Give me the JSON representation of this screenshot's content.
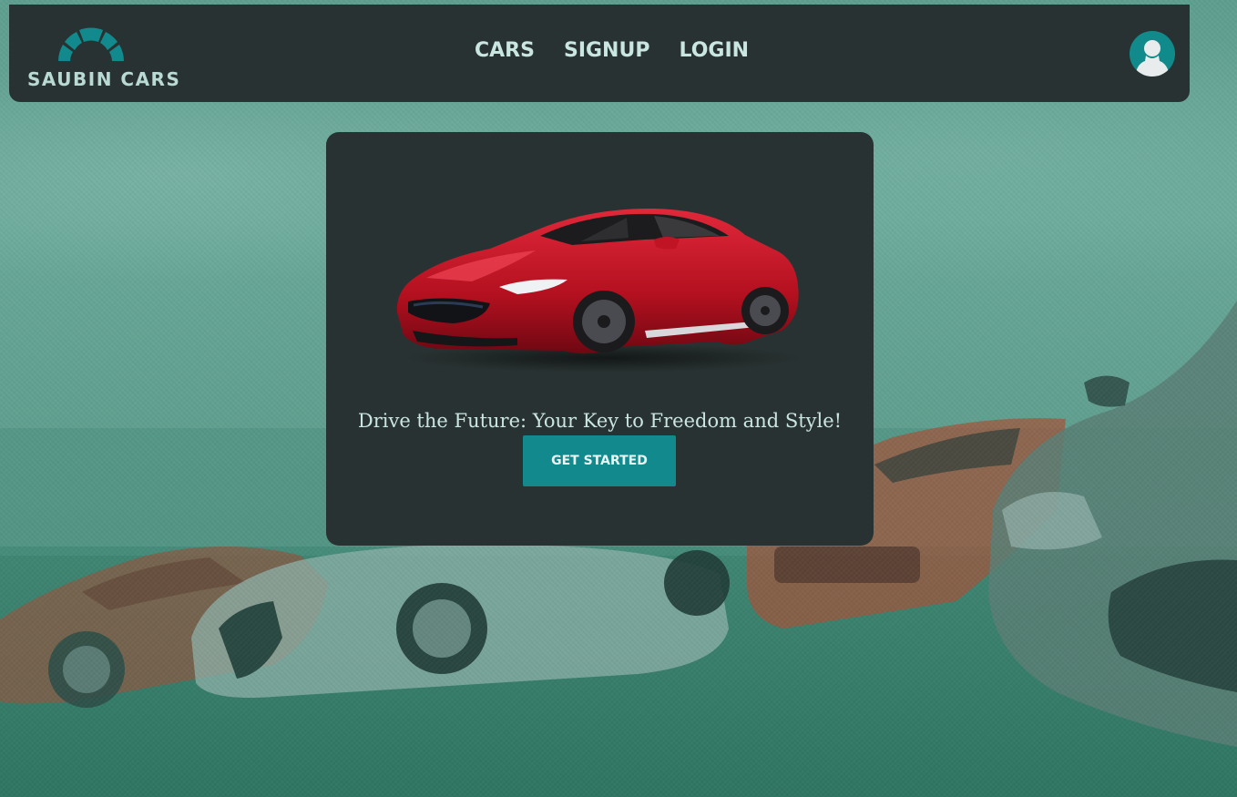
{
  "brand": {
    "name": "SAUBIN CARS"
  },
  "nav": {
    "items": [
      {
        "label": "CARS"
      },
      {
        "label": "SIGNUP"
      },
      {
        "label": "LOGIN"
      }
    ]
  },
  "hero": {
    "tagline": "Drive the Future: Your Key to Freedom and Style!",
    "cta_label": "GET STARTED"
  },
  "icons": {
    "logo": "logo-icon",
    "user": "user-avatar-icon"
  },
  "colors": {
    "header_bg": "#293232",
    "card_bg": "#293232",
    "accent": "#128a8d",
    "nav_text": "#c9e6e0",
    "background": "#4f9886"
  }
}
